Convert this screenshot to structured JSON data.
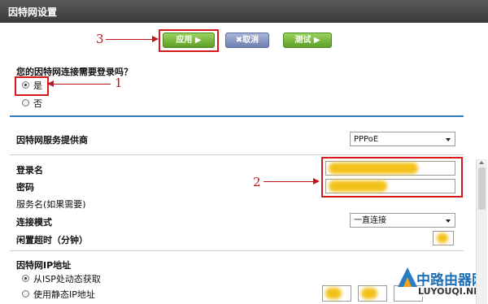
{
  "window": {
    "title": "因特网设置"
  },
  "toolbar": {
    "apply_label": "应用 ▶",
    "cancel_label": "✖取消",
    "test_label": "测试 ▶"
  },
  "annotations": {
    "one": "1",
    "two": "2",
    "three": "3"
  },
  "login": {
    "question": "您的因特网连接需要登录吗？",
    "yes": "是",
    "no": "否",
    "selected": "是"
  },
  "isp": {
    "label": "因特网服务提供商",
    "value": "PPPoE"
  },
  "account": {
    "username_label": "登录名",
    "password_label": "密码",
    "service_label": "服务名(如果需要)",
    "mode_label": "连接模式",
    "mode_value": "一直连接",
    "idle_label": "闲置超时（分钟）"
  },
  "ip": {
    "section_label": "因特网IP地址",
    "auto": "从ISP处动态获取",
    "static": "使用静态IP地址",
    "selected": "从ISP处动态获取"
  },
  "watermark": {
    "brand": "中路由器网",
    "site": "LUYOUQI.NET"
  },
  "colors": {
    "accent": "#2f7ec0",
    "annotation": "#c0151c",
    "apply_green": "#6fae35",
    "cancel_blue": "#7585b6"
  }
}
